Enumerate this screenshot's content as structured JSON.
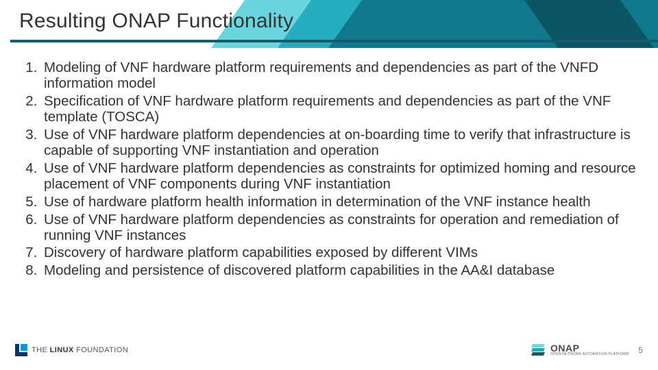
{
  "title": "Resulting ONAP Functionality",
  "points": [
    "Modeling of VNF hardware platform requirements and dependencies as part of the VNFD information model",
    "Specification of VNF hardware platform requirements and dependencies as part of the VNF template (TOSCA)",
    "Use of VNF hardware platform dependencies at on-boarding time to verify that infrastructure is capable of supporting VNF instantiation and operation",
    "Use of VNF hardware platform dependencies as constraints for optimized homing and resource placement of VNF components during VNF instantiation",
    "Use of hardware platform health information in determination of the VNF instance health",
    "Use of VNF hardware platform dependencies as constraints for operation and remediation of running VNF instances",
    "Discovery of hardware platform capabilities exposed by different VIMs",
    "Modeling and persistence of discovered platform capabilities in the AA&I database"
  ],
  "footer": {
    "lf_the": "THE",
    "lf_linux": "LINUX",
    "lf_foundation": "FOUNDATION",
    "onap_main": "ONAP",
    "onap_sub": "OPEN NETWORK AUTOMATION PLATFORM",
    "page": "5"
  }
}
